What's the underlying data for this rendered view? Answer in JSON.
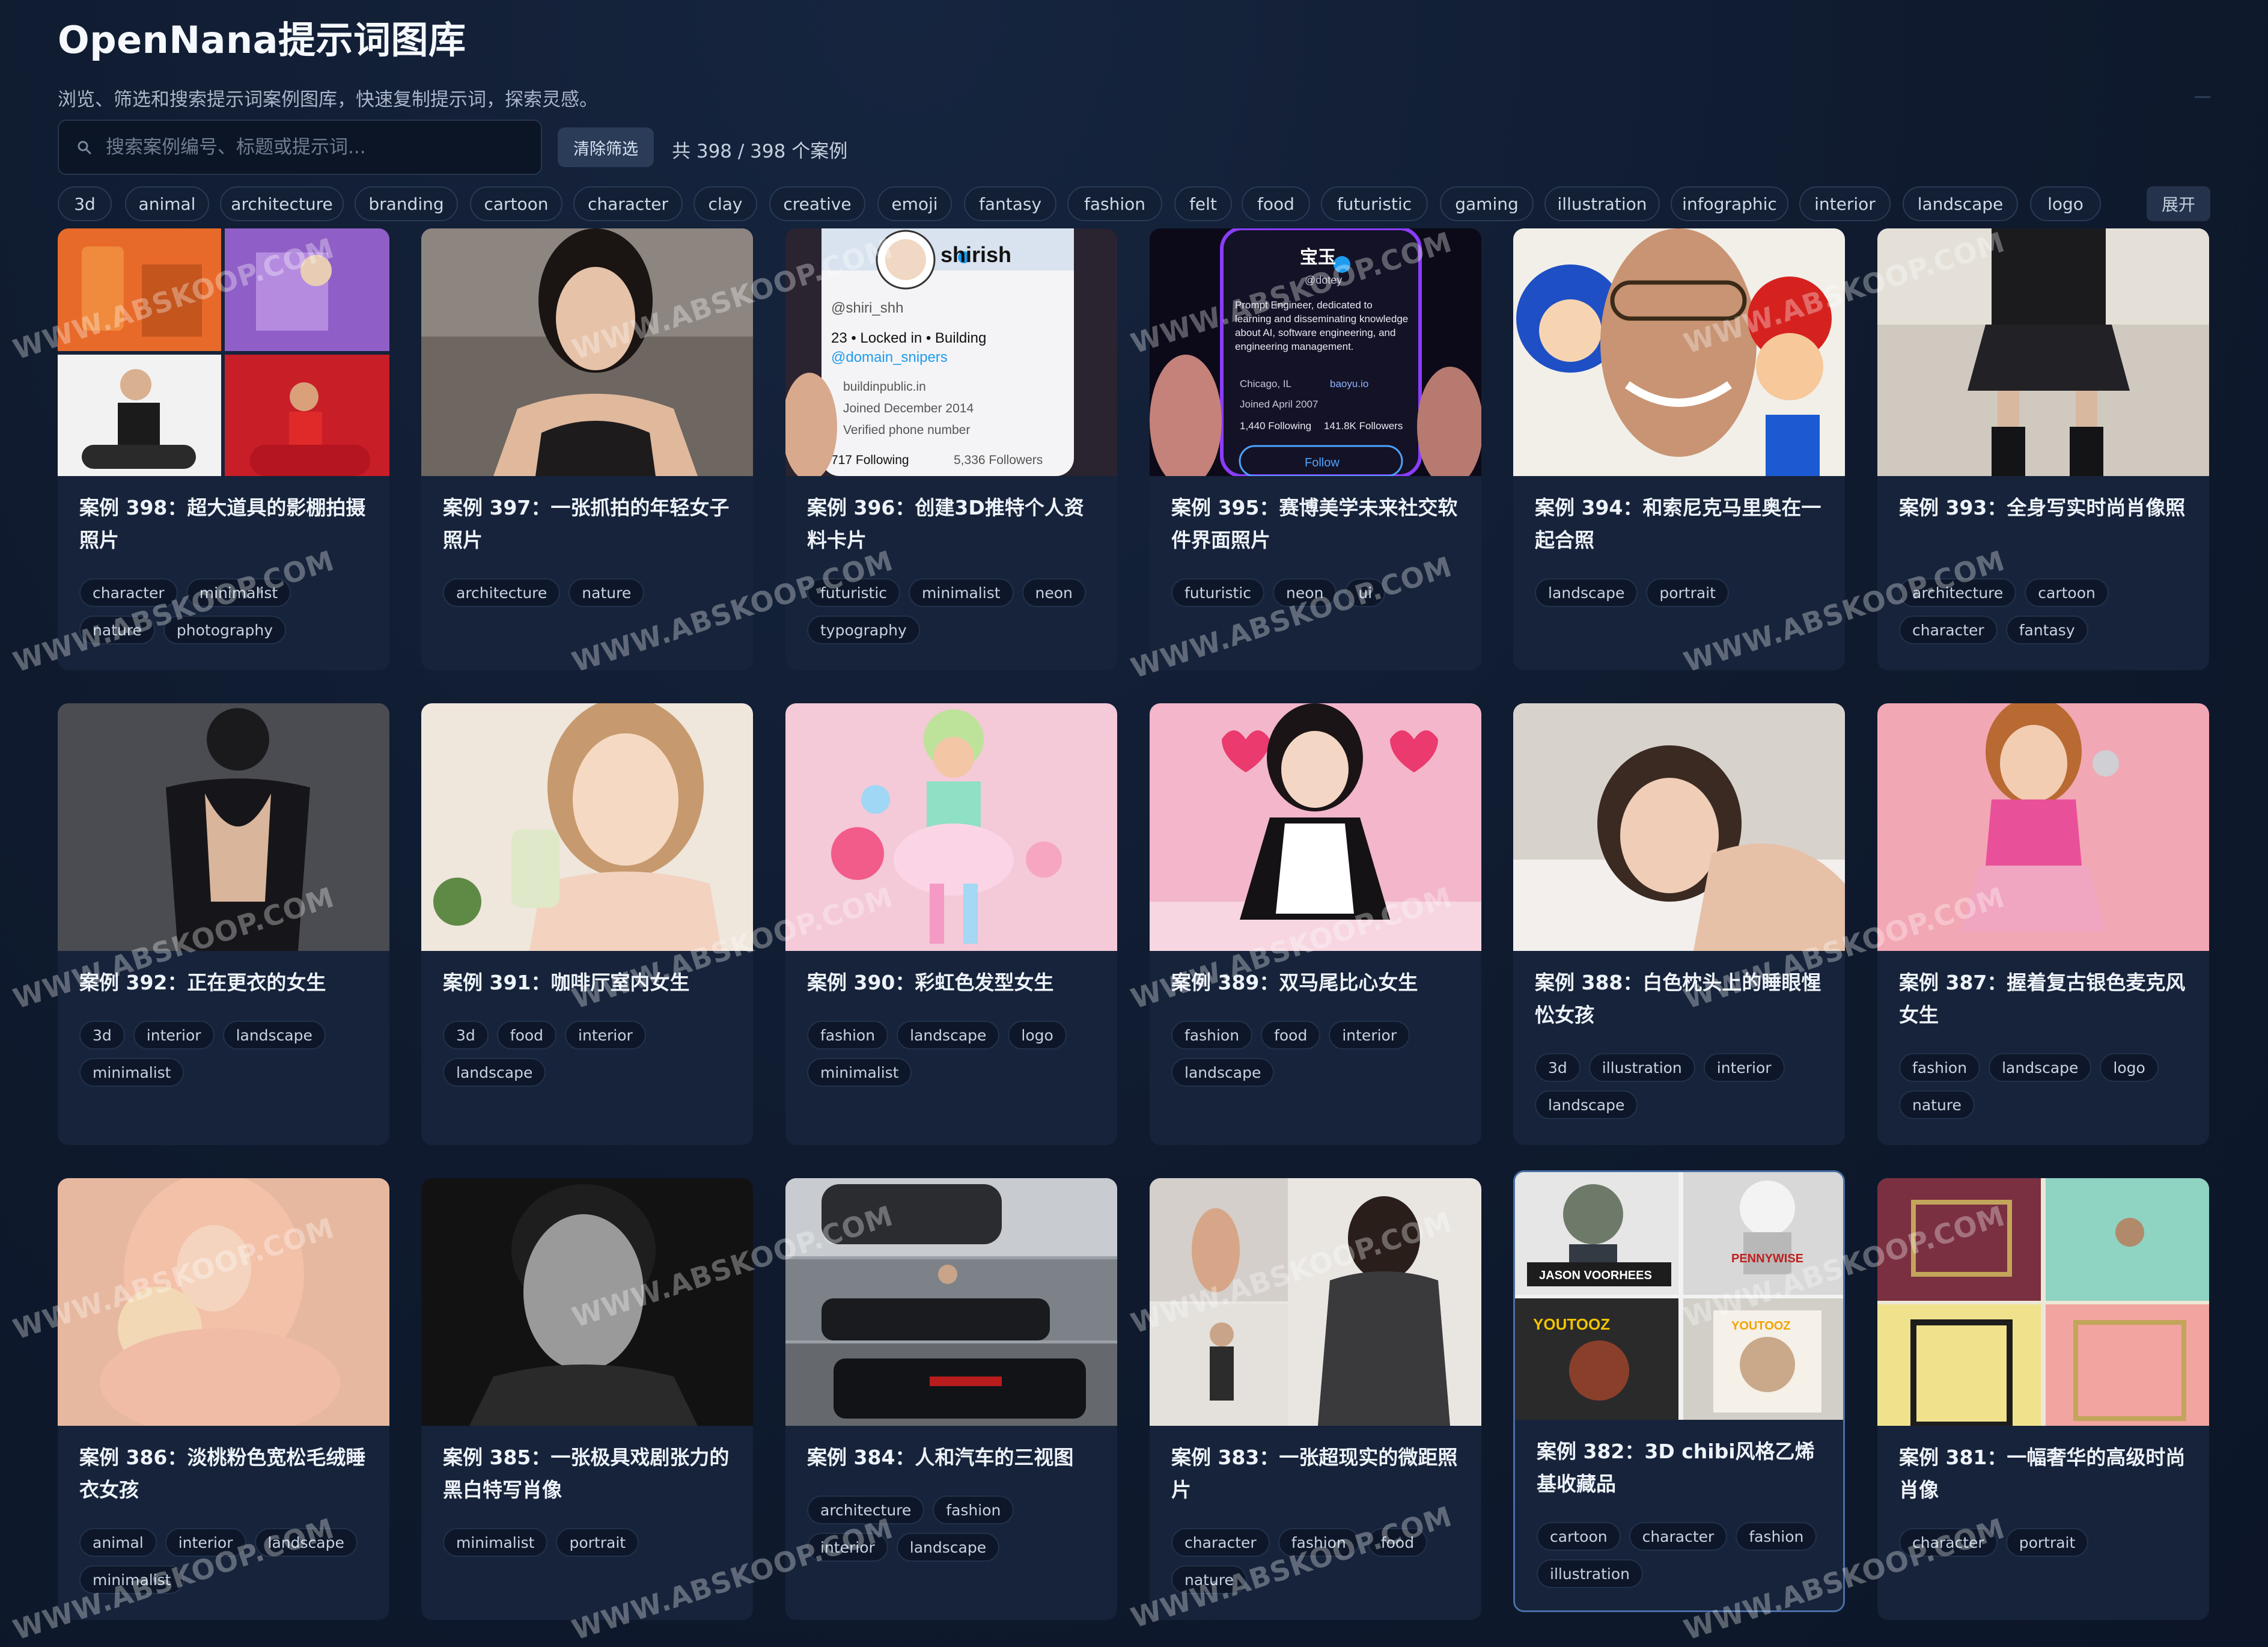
{
  "header": {
    "title": "OpenNana提示词图库",
    "subtitle": "浏览、筛选和搜索提示词案例图库，快速复制提示词，探索灵感。",
    "search_placeholder": "搜索案例编号、标题或提示词...",
    "clear_label": "清除筛选",
    "count_text": "共 398 / 398 个案例"
  },
  "tags": [
    "3d",
    "animal",
    "architecture",
    "branding",
    "cartoon",
    "character",
    "clay",
    "creative",
    "emoji",
    "fantasy",
    "fashion",
    "felt",
    "food",
    "futuristic",
    "gaming",
    "illustration",
    "infographic",
    "interior",
    "landscape",
    "logo"
  ],
  "expand_label": "展开",
  "watermark_text": "WWW.ABSKOOP.COM",
  "image_text": {
    "shirish_name": "shirish",
    "shirish_handle": "@shiri_shh",
    "shirish_bio": "23 • Locked in • Building",
    "shirish_mention": "@domain_snipers",
    "shirish_url": "buildinpublic.in",
    "shirish_joined": "Joined December 2014",
    "shirish_verified": "Verified phone number",
    "shirish_following": "717 Following",
    "shirish_followers": "5,336 Followers",
    "dotey_name": "宝玉",
    "dotey_handle": "@dotey",
    "dotey_bio": "Prompt Engineer, dedicated to learning and disseminating knowledge about AI, software engineering, and engineering management.",
    "dotey_location": "Chicago, IL",
    "dotey_site": "baoyu.io",
    "dotey_joined": "Joined April 2007",
    "dotey_following": "1,440 Following",
    "dotey_followers": "141.8K Followers",
    "dotey_follow": "Follow",
    "box_jason": "JASON VOORHEES",
    "box_youtooz": "YOUTOOZ",
    "box_pennywise": "PENNYWISE"
  },
  "cards": [
    {
      "title": "案例 398：超大道具的影棚拍摄照片",
      "tags": [
        "character",
        "minimalist",
        "nature",
        "photography"
      ]
    },
    {
      "title": "案例 397：一张抓拍的年轻女子照片",
      "tags": [
        "architecture",
        "nature"
      ]
    },
    {
      "title": "案例 396：创建3D推特个人资料卡片",
      "tags": [
        "futuristic",
        "minimalist",
        "neon",
        "typography"
      ]
    },
    {
      "title": "案例 395：赛博美学未来社交软件界面照片",
      "tags": [
        "futuristic",
        "neon",
        "ui"
      ]
    },
    {
      "title": "案例 394：和索尼克马里奥在一起合照",
      "tags": [
        "landscape",
        "portrait"
      ]
    },
    {
      "title": "案例 393：全身写实时尚肖像照",
      "tags": [
        "architecture",
        "cartoon",
        "character",
        "fantasy"
      ]
    },
    {
      "title": "案例 392：正在更衣的女生",
      "tags": [
        "3d",
        "interior",
        "landscape",
        "minimalist"
      ]
    },
    {
      "title": "案例 391：咖啡厅室内女生",
      "tags": [
        "3d",
        "food",
        "interior",
        "landscape"
      ]
    },
    {
      "title": "案例 390：彩虹色发型女生",
      "tags": [
        "fashion",
        "landscape",
        "logo",
        "minimalist"
      ]
    },
    {
      "title": "案例 389：双马尾比心女生",
      "tags": [
        "fashion",
        "food",
        "interior",
        "landscape"
      ]
    },
    {
      "title": "案例 388：白色枕头上的睡眼惺忪女孩",
      "tags": [
        "3d",
        "illustration",
        "interior",
        "landscape"
      ]
    },
    {
      "title": "案例 387：握着复古银色麦克风女生",
      "tags": [
        "fashion",
        "landscape",
        "logo",
        "nature"
      ]
    },
    {
      "title": "案例 386：淡桃粉色宽松毛绒睡衣女孩",
      "tags": [
        "animal",
        "interior",
        "landscape",
        "minimalist"
      ]
    },
    {
      "title": "案例 385：一张极具戏剧张力的黑白特写肖像",
      "tags": [
        "minimalist",
        "portrait"
      ]
    },
    {
      "title": "案例 384：人和汽车的三视图",
      "tags": [
        "architecture",
        "fashion",
        "interior",
        "landscape"
      ]
    },
    {
      "title": "案例 383：一张超现实的微距照片",
      "tags": [
        "character",
        "fashion",
        "food",
        "nature"
      ]
    },
    {
      "title": "案例 382：3D chibi风格乙烯基收藏品",
      "tags": [
        "cartoon",
        "character",
        "fashion",
        "illustration"
      ]
    },
    {
      "title": "案例 381：一幅奢华的高级时尚肖像",
      "tags": [
        "character",
        "portrait"
      ]
    }
  ]
}
